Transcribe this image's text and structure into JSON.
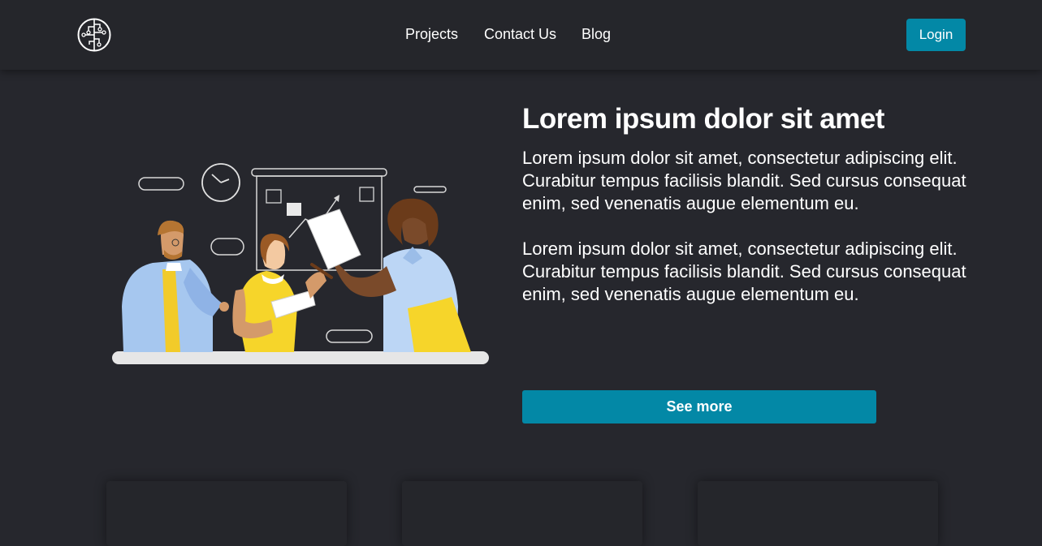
{
  "colors": {
    "background": "#26272d",
    "navbar": "#25262b",
    "accent": "#0388a6",
    "text": "#ffffff"
  },
  "logo": {
    "icon": "circuit-brain-logo-icon"
  },
  "nav": {
    "links": [
      "Projects",
      "Contact Us",
      "Blog"
    ],
    "login_label": "Login"
  },
  "hero": {
    "illustration": "team-presentation-illustration",
    "title": "Lorem ipsum dolor sit amet",
    "paragraphs": [
      "Lorem ipsum dolor sit amet, consectetur adipiscing elit. Curabitur tempus facilisis blandit. Sed cursus consequat enim, sed venenatis augue elementum eu.",
      "Lorem ipsum dolor sit amet, consectetur adipiscing elit. Curabitur tempus facilisis blandit. Sed cursus consequat enim, sed venenatis augue elementum eu."
    ],
    "cta_label": "See more"
  },
  "cards": [
    {},
    {},
    {}
  ]
}
